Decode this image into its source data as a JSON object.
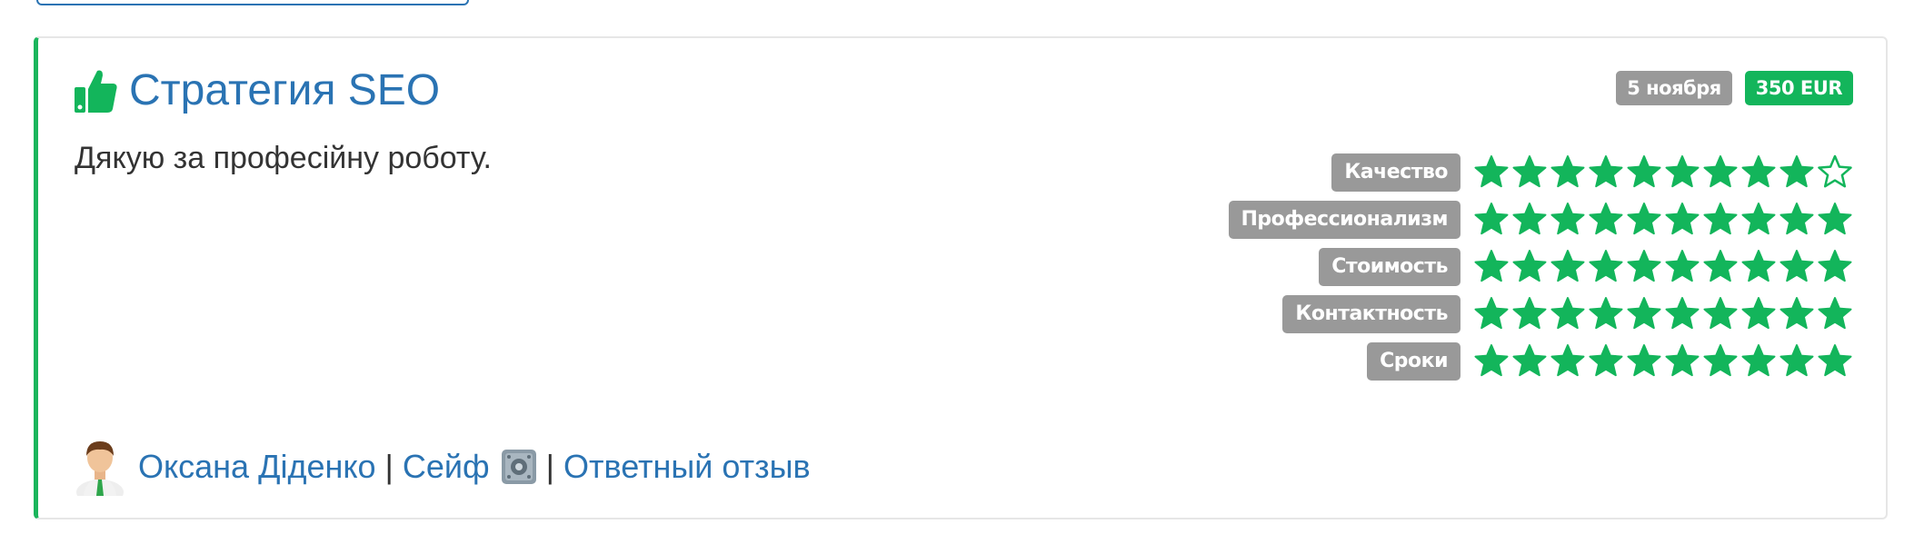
{
  "review": {
    "title": "Стратегия SEO",
    "date": "5 ноября",
    "price": "350 EUR",
    "comment": "Дякую за професійну роботу.",
    "accent_color": "#13b55b",
    "link_color": "#2a73b3"
  },
  "ratings": [
    {
      "label": "Качество",
      "score": 9,
      "max": 10
    },
    {
      "label": "Профессионализм",
      "score": 10,
      "max": 10
    },
    {
      "label": "Стоимость",
      "score": 10,
      "max": 10
    },
    {
      "label": "Контактность",
      "score": 10,
      "max": 10
    },
    {
      "label": "Сроки",
      "score": 10,
      "max": 10
    }
  ],
  "footer": {
    "author": "Оксана Діденко",
    "separator": "|",
    "safe_label": "Сейф",
    "reply_label": "Ответный отзыв"
  },
  "icons": {
    "title_icon": "thumbs-up-icon",
    "author_icon": "avatar-icon",
    "safe_icon": "safe-icon",
    "star_filled": "star-filled-icon",
    "star_empty": "star-outline-icon"
  }
}
